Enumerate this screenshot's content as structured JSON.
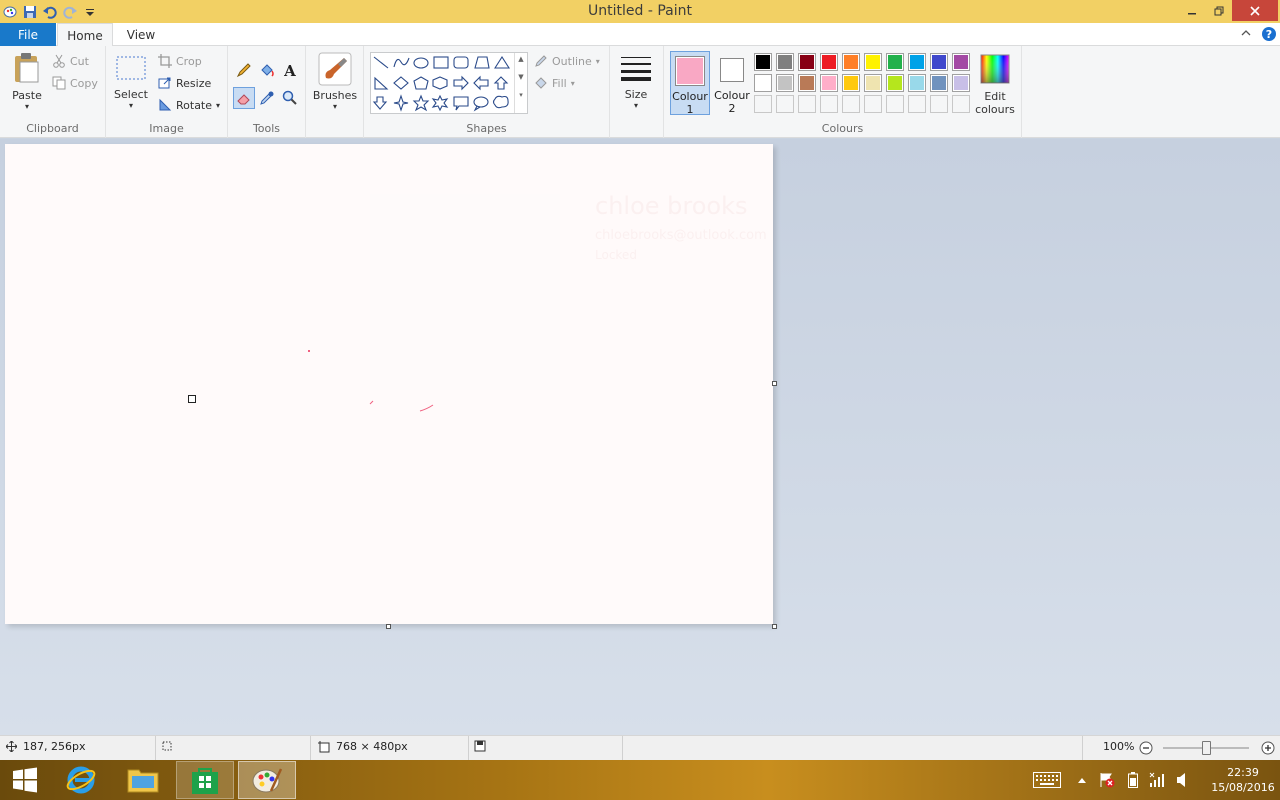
{
  "window": {
    "title": "Untitled - Paint"
  },
  "tabs": {
    "file": "File",
    "home": "Home",
    "view": "View"
  },
  "clipboard": {
    "paste": "Paste",
    "cut": "Cut",
    "copy": "Copy",
    "label": "Clipboard"
  },
  "image": {
    "select": "Select",
    "crop": "Crop",
    "resize": "Resize",
    "rotate": "Rotate",
    "label": "Image"
  },
  "tools": {
    "label": "Tools"
  },
  "brushes": {
    "label": "Brushes"
  },
  "shapes": {
    "outline": "Outline",
    "fill": "Fill",
    "label": "Shapes"
  },
  "size": {
    "label": "Size"
  },
  "colours": {
    "colour1_a": "Colour",
    "colour1_b": "1",
    "colour2_a": "Colour",
    "colour2_b": "2",
    "edit_a": "Edit",
    "edit_b": "colours",
    "label": "Colours",
    "colour1_value": "#f9a8c4",
    "colour2_value": "#ffffff",
    "row1": [
      "#000000",
      "#7f7f7f",
      "#880015",
      "#ed1c24",
      "#ff7f27",
      "#fff200",
      "#22b14c",
      "#00a2e8",
      "#3f48cc",
      "#a349a4"
    ],
    "row2": [
      "#ffffff",
      "#c3c3c3",
      "#b97a57",
      "#ffaec9",
      "#ffc90e",
      "#efe4b0",
      "#b5e61d",
      "#99d9ea",
      "#7092be",
      "#c8bfe7"
    ]
  },
  "canvas": {
    "faint_name": "chloe brooks",
    "faint_email": "chloebrooks@outlook.com",
    "faint_status": "Locked"
  },
  "status": {
    "cursor": "187, 256px",
    "size": "768 × 480px",
    "zoom": "100%"
  },
  "taskbar": {
    "time": "22:39",
    "date": "15/08/2016"
  }
}
